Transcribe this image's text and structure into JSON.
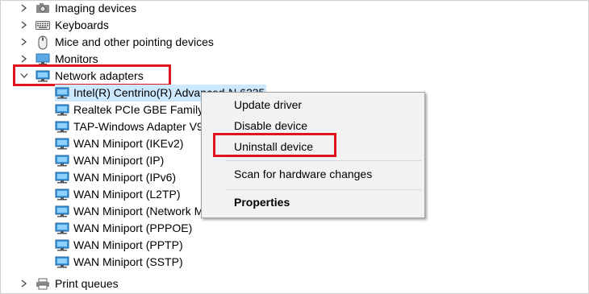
{
  "tree": {
    "imaging_devices": "Imaging devices",
    "keyboards": "Keyboards",
    "mice": "Mice and other pointing devices",
    "monitors": "Monitors",
    "network_adapters": "Network adapters",
    "adapters": [
      "Intel(R) Centrino(R) Advanced-N 6235",
      "Realtek PCIe GBE Family",
      "TAP-Windows Adapter V9",
      "WAN Miniport (IKEv2)",
      "WAN Miniport (IP)",
      "WAN Miniport (IPv6)",
      "WAN Miniport (L2TP)",
      "WAN Miniport (Network Monitor)",
      "WAN Miniport (PPPOE)",
      "WAN Miniport (PPTP)",
      "WAN Miniport (SSTP)"
    ],
    "print_queues": "Print queues"
  },
  "context_menu": {
    "update_driver": "Update driver",
    "disable_device": "Disable device",
    "uninstall_device": "Uninstall device",
    "scan_hardware": "Scan for hardware changes",
    "properties": "Properties"
  },
  "colors": {
    "highlight_box": "#e0141e",
    "selection": "#cce8ff",
    "menu_background": "#f2f2f2"
  }
}
